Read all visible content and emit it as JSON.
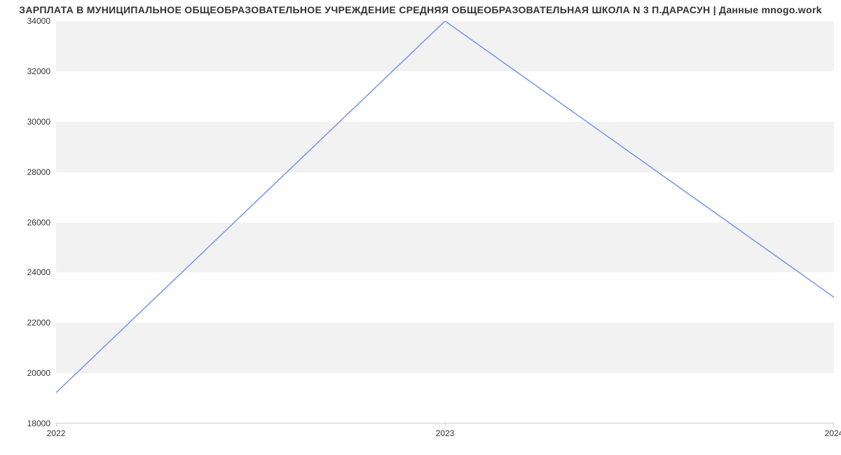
{
  "chart_data": {
    "type": "line",
    "title": "ЗАРПЛАТА В МУНИЦИПАЛЬНОЕ ОБЩЕОБРАЗОВАТЕЛЬНОЕ УЧРЕЖДЕНИЕ СРЕДНЯЯ ОБЩЕОБРАЗОВАТЕЛЬНАЯ ШКОЛА N 3 П.ДАРАСУН | Данные mnogo.work",
    "x": [
      "2022",
      "2023",
      "2024"
    ],
    "values": [
      19200,
      34000,
      23000
    ],
    "ylim": [
      18000,
      34000
    ],
    "y_ticks": [
      18000,
      20000,
      22000,
      24000,
      26000,
      28000,
      30000,
      32000,
      34000
    ],
    "x_ticks": [
      "2022",
      "2023",
      "2024"
    ],
    "xlabel": "",
    "ylabel": "",
    "line_color": "#7f9be8"
  }
}
